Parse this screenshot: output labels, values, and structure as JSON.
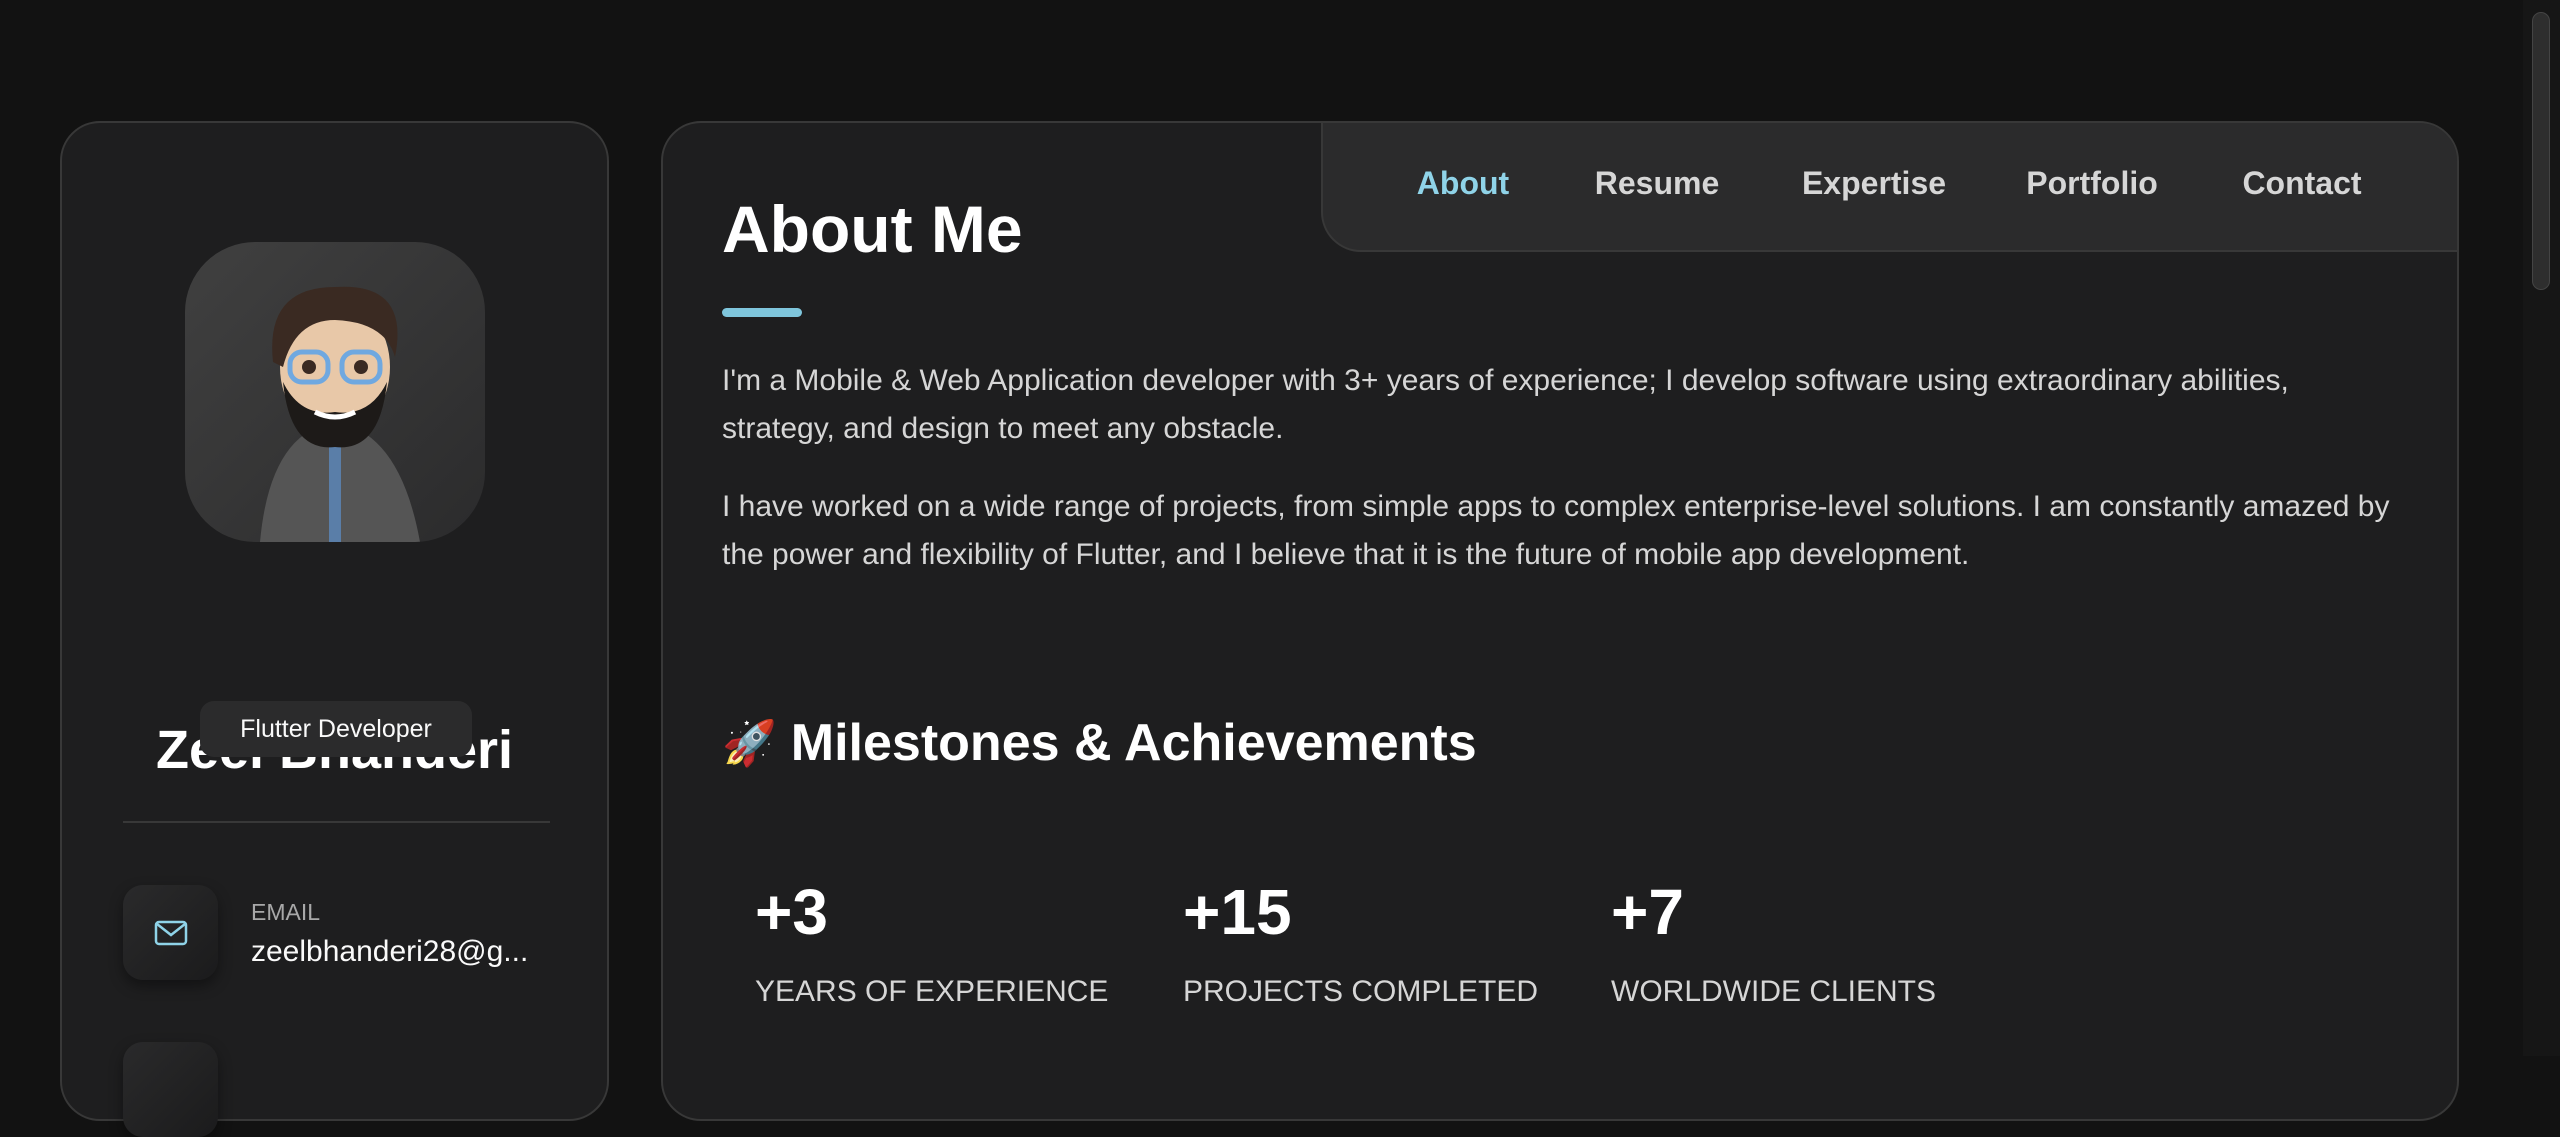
{
  "profile": {
    "name": "Zeel Bhanderi",
    "role": "Flutter Developer",
    "contacts": [
      {
        "icon": "mail-icon",
        "label": "EMAIL",
        "value": "zeelbhanderi28@g..."
      }
    ]
  },
  "nav": {
    "items": [
      {
        "label": "About",
        "active": true
      },
      {
        "label": "Resume"
      },
      {
        "label": "Expertise"
      },
      {
        "label": "Portfolio"
      },
      {
        "label": "Contact"
      }
    ]
  },
  "about": {
    "title": "About Me",
    "paragraphs": [
      "I'm a Mobile & Web Application developer with 3+ years of experience; I develop software using extraordinary abilities, strategy, and design to meet any obstacle.",
      "I have worked on a wide range of projects, from simple apps to complex enterprise-level solutions. I am constantly amazed by the power and flexibility of Flutter, and I believe that it is the future of mobile app development."
    ],
    "milestones_icon": "🚀",
    "milestones_title": "Milestones & Achievements",
    "stats": [
      {
        "value": "+3",
        "label": "YEARS OF EXPERIENCE"
      },
      {
        "value": "+15",
        "label": "PROJECTS COMPLETED"
      },
      {
        "value": "+7",
        "label": "WORLDWIDE CLIENTS"
      }
    ]
  },
  "colors": {
    "accent": "#8fd3e8",
    "background": "#121212",
    "card": "#1e1e1f"
  }
}
